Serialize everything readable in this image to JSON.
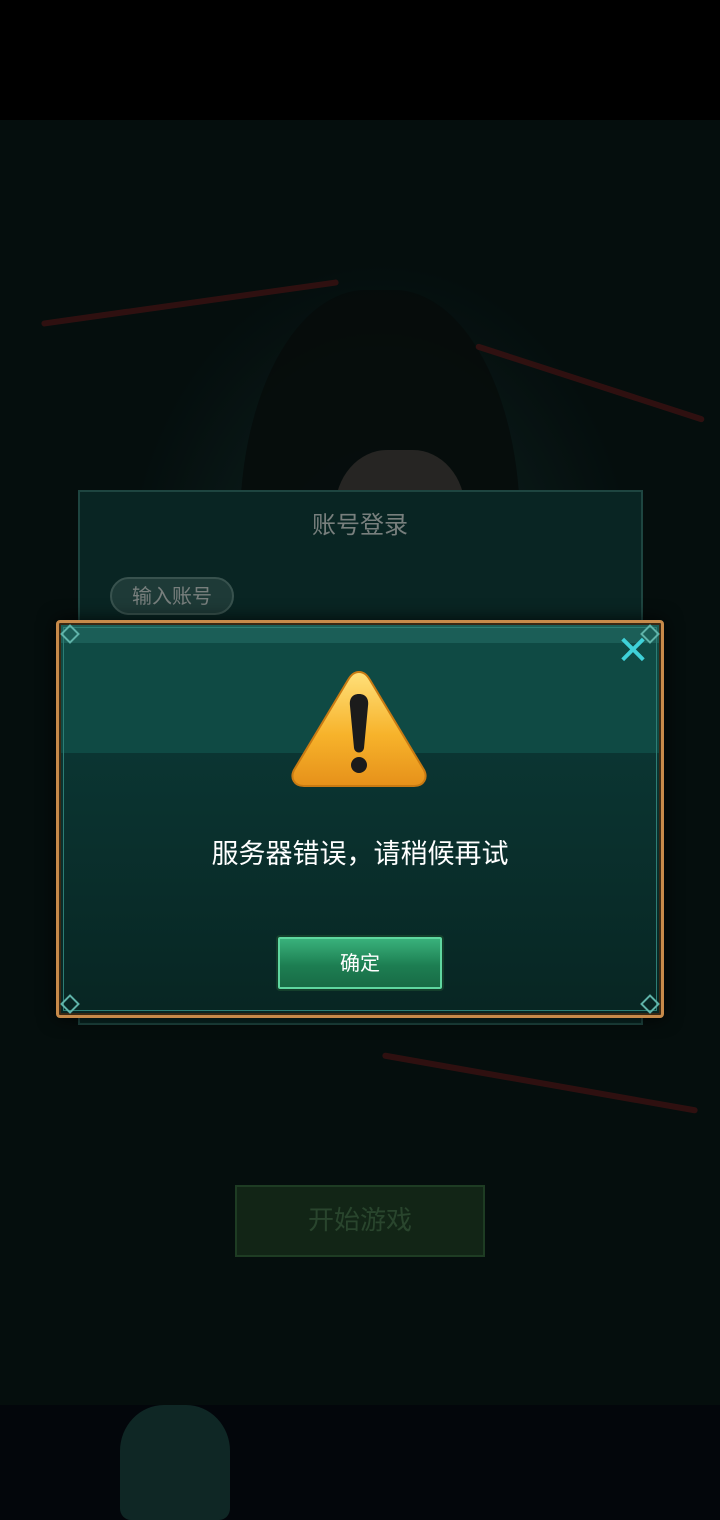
{
  "login": {
    "title": "账号登录",
    "account_label": "输入账号",
    "start_button": "开始游戏"
  },
  "dialog": {
    "message": "服务器错误，请稍候再试",
    "confirm_label": "确定",
    "close_icon": "close-icon",
    "warning_icon": "warning-triangle-icon"
  },
  "colors": {
    "dialog_border": "#c78a4a",
    "dialog_bg": "#0f4a44",
    "close_icon": "#3fd1d8",
    "confirm_button": "#1d7e52",
    "warning": "#f5b020"
  }
}
